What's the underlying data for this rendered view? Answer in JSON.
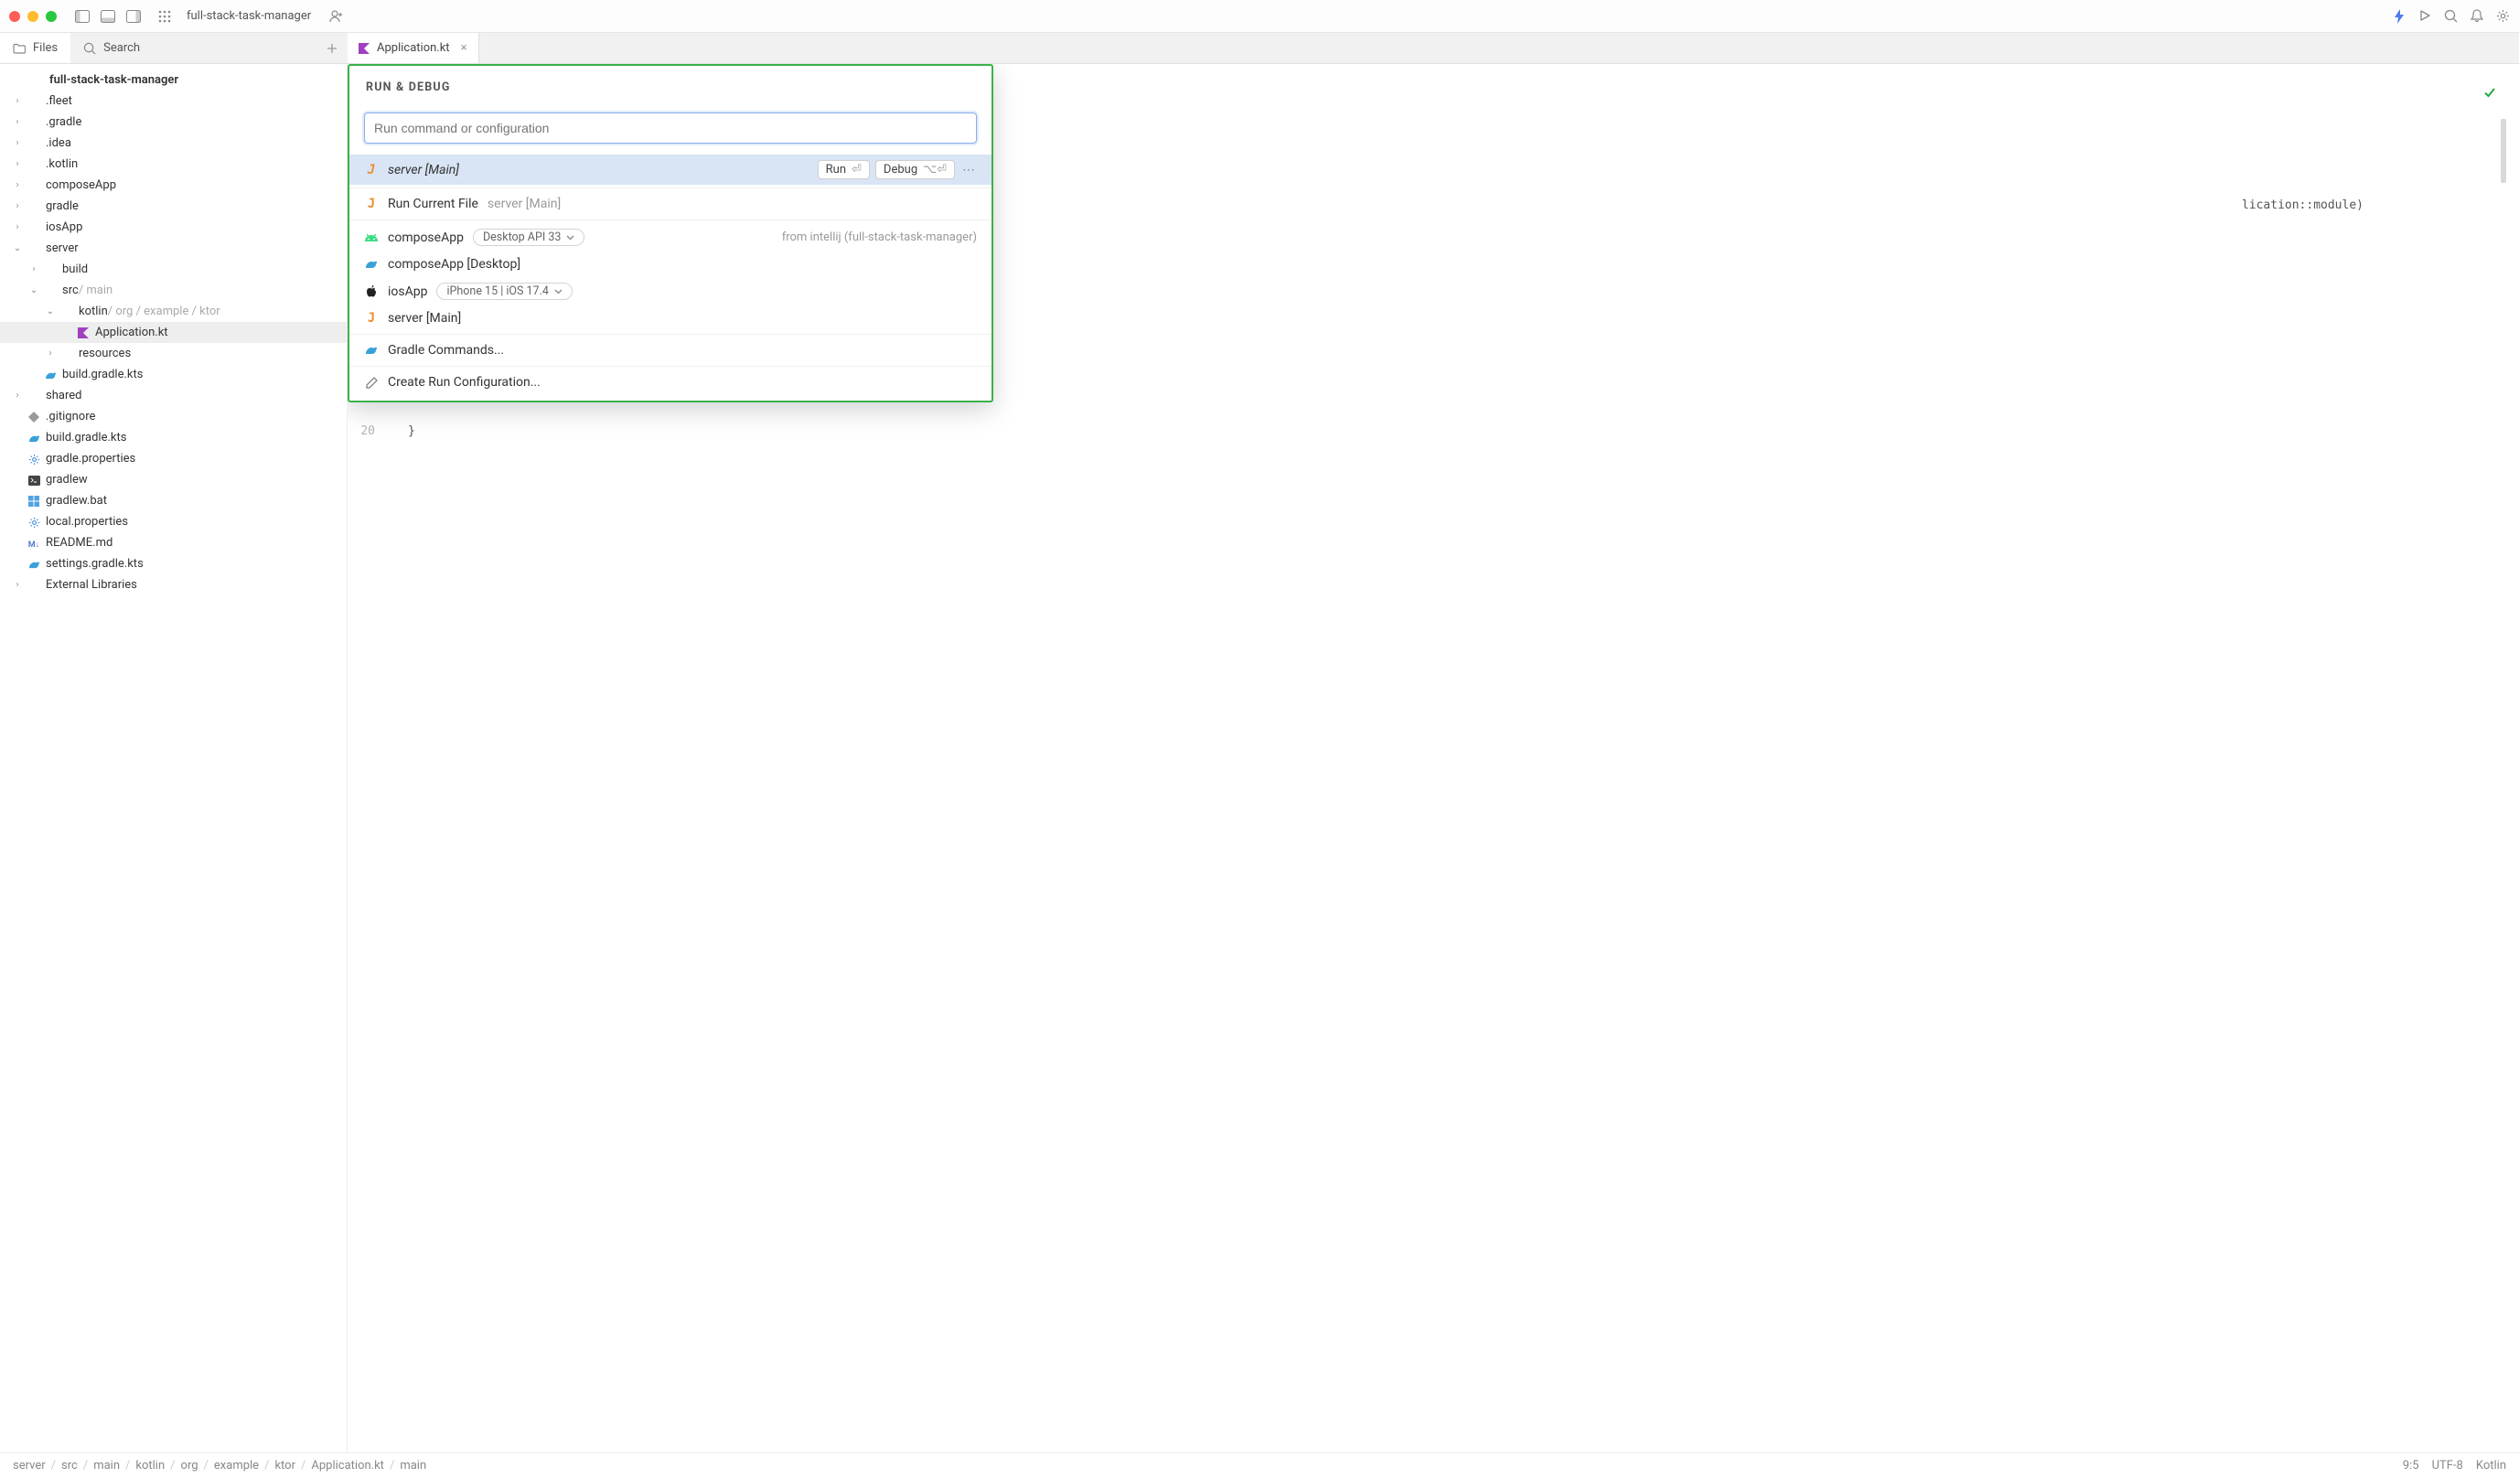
{
  "titlebar": {
    "project": "full-stack-task-manager"
  },
  "side_tabs": {
    "files": "Files",
    "search": "Search"
  },
  "editor_tab": {
    "filename": "Application.kt"
  },
  "tree": [
    {
      "depth": 0,
      "chevron": "",
      "icon": "",
      "text": "full-stack-task-manager",
      "bold": true
    },
    {
      "depth": 0,
      "chevron": "›",
      "icon": "",
      "text": ".fleet"
    },
    {
      "depth": 0,
      "chevron": "›",
      "icon": "",
      "text": ".gradle"
    },
    {
      "depth": 0,
      "chevron": "›",
      "icon": "",
      "text": ".idea"
    },
    {
      "depth": 0,
      "chevron": "›",
      "icon": "",
      "text": ".kotlin"
    },
    {
      "depth": 0,
      "chevron": "›",
      "icon": "",
      "text": "composeApp"
    },
    {
      "depth": 0,
      "chevron": "›",
      "icon": "",
      "text": "gradle"
    },
    {
      "depth": 0,
      "chevron": "›",
      "icon": "",
      "text": "iosApp"
    },
    {
      "depth": 0,
      "chevron": "⌄",
      "icon": "",
      "text": "server"
    },
    {
      "depth": 1,
      "chevron": "›",
      "icon": "",
      "text": "build"
    },
    {
      "depth": 1,
      "chevron": "⌄",
      "icon": "",
      "text": "src",
      "suffix": " / main"
    },
    {
      "depth": 2,
      "chevron": "⌄",
      "icon": "",
      "text": "kotlin",
      "suffix": " / org / example / ktor"
    },
    {
      "depth": 3,
      "chevron": "",
      "icon": "kotlin",
      "text": "Application.kt",
      "selected": true
    },
    {
      "depth": 2,
      "chevron": "›",
      "icon": "",
      "text": "resources"
    },
    {
      "depth": 1,
      "chevron": "",
      "icon": "gradle",
      "text": "build.gradle.kts"
    },
    {
      "depth": 0,
      "chevron": "›",
      "icon": "",
      "text": "shared"
    },
    {
      "depth": 0,
      "chevron": "",
      "icon": "gitignore",
      "text": ".gitignore"
    },
    {
      "depth": 0,
      "chevron": "",
      "icon": "gradle",
      "text": "build.gradle.kts"
    },
    {
      "depth": 0,
      "chevron": "",
      "icon": "gear",
      "text": "gradle.properties"
    },
    {
      "depth": 0,
      "chevron": "",
      "icon": "terminal",
      "text": "gradlew"
    },
    {
      "depth": 0,
      "chevron": "",
      "icon": "win",
      "text": "gradlew.bat"
    },
    {
      "depth": 0,
      "chevron": "",
      "icon": "gear",
      "text": "local.properties"
    },
    {
      "depth": 0,
      "chevron": "",
      "icon": "md",
      "text": "README.md"
    },
    {
      "depth": 0,
      "chevron": "",
      "icon": "gradle",
      "text": "settings.gradle.kts"
    },
    {
      "depth": 0,
      "chevron": "›",
      "icon": "",
      "text": "External Libraries"
    }
  ],
  "code_peek": {
    "line_fragment": "lication::module)",
    "line20_num": "20",
    "line20_code": "}"
  },
  "popover": {
    "title": "RUN & DEBUG",
    "placeholder": "Run command or configuration",
    "run_btn": "Run",
    "debug_btn": "Debug",
    "debug_shortcut": "⌥⏎",
    "run_shortcut": "⏎",
    "items": {
      "server_main": "server [Main]",
      "run_current_file": "Run Current File",
      "run_current_file_extra": "server [Main]",
      "composeApp": "composeApp",
      "composeApp_pill": "Desktop API 33",
      "composeApp_desktop": "composeApp [Desktop]",
      "iosApp": "iosApp",
      "iosApp_pill": "iPhone 15 | iOS 17.4",
      "server_main2": "server [Main]",
      "gradle_commands": "Gradle Commands...",
      "create_config": "Create Run Configuration...",
      "origin": "from intellij (full-stack-task-manager)"
    }
  },
  "statusbar": {
    "breadcrumbs": [
      "server",
      "src",
      "main",
      "kotlin",
      "org",
      "example",
      "ktor",
      "Application.kt",
      "main"
    ],
    "cursor": "9:5",
    "encoding": "UTF-8",
    "lang": "Kotlin"
  }
}
